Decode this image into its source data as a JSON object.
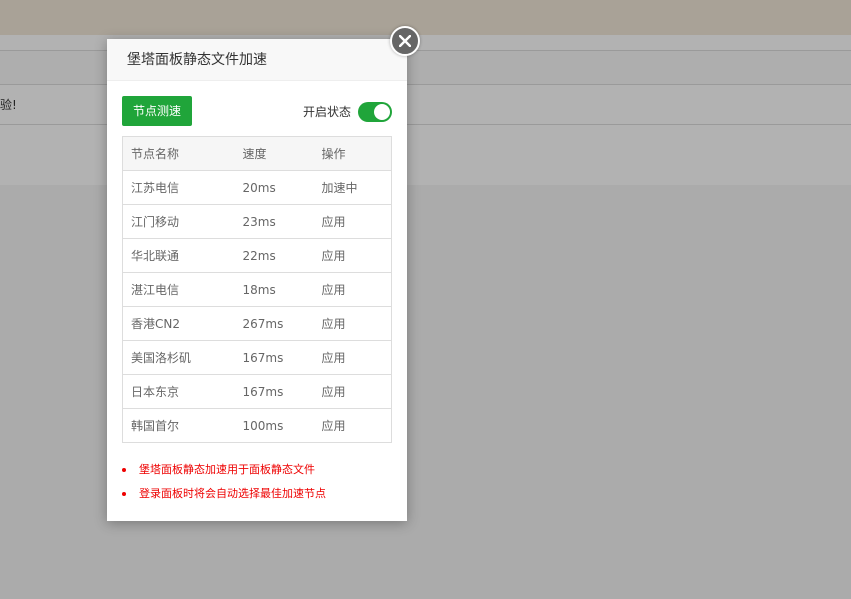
{
  "background": {
    "row_text": "验!"
  },
  "dialog": {
    "title": "堡塔面板静态文件加速",
    "speed_test_button": "节点测速",
    "switch_label": "开启状态",
    "switch_on": true,
    "columns": [
      "节点名称",
      "速度",
      "操作"
    ],
    "rows": [
      {
        "name": "江苏电信",
        "speed": "20ms",
        "action": "加速中",
        "active": true
      },
      {
        "name": "江门移动",
        "speed": "23ms",
        "action": "应用",
        "active": false
      },
      {
        "name": "华北联通",
        "speed": "22ms",
        "action": "应用",
        "active": false
      },
      {
        "name": "湛江电信",
        "speed": "18ms",
        "action": "应用",
        "active": false
      },
      {
        "name": "香港CN2",
        "speed": "267ms",
        "action": "应用",
        "active": false
      },
      {
        "name": "美国洛杉矶",
        "speed": "167ms",
        "action": "应用",
        "active": false
      },
      {
        "name": "日本东京",
        "speed": "167ms",
        "action": "应用",
        "active": false
      },
      {
        "name": "韩国首尔",
        "speed": "100ms",
        "action": "应用",
        "active": false
      }
    ],
    "notes": [
      "堡塔面板静态加速用于面板静态文件",
      "登录面板时将会自动选择最佳加速节点"
    ]
  },
  "colors": {
    "accent": "#20a53a",
    "active_action": "#f0600a",
    "note": "#ee0000"
  },
  "icons": {
    "close": "close-icon"
  }
}
